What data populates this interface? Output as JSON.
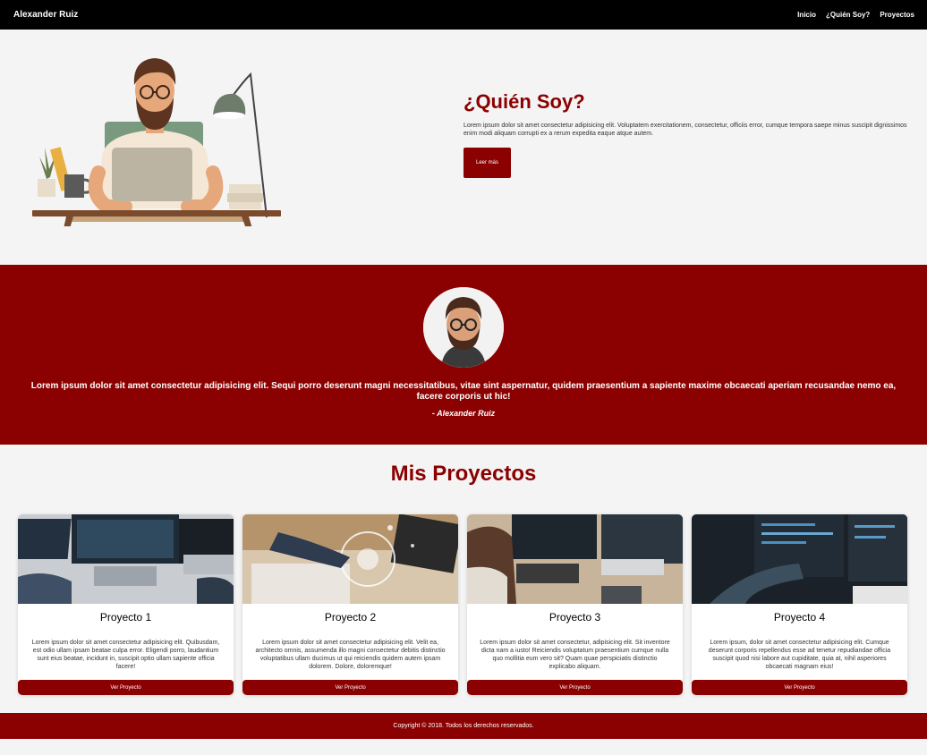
{
  "nav": {
    "brand": "Alexander Ruiz",
    "links": [
      "Inicio",
      "¿Quién Soy?",
      "Proyectos"
    ]
  },
  "about": {
    "title": "¿Quién Soy?",
    "description": "Lorem ipsum dolor sit amet consectetur adipisicing elit. Voluptatem exercitationem, consectetur, officiis error, cumque tempora saepe minus suscipit dignissimos enim modi aliquam corrupti ex a rerum expedita eaque atque autem.",
    "button_label": "Leer más"
  },
  "quote": {
    "text": "Lorem ipsum dolor sit amet consectetur adipisicing elit. Sequi porro deserunt magni necessitatibus, vitae sint aspernatur, quidem praesentium a sapiente maxime obcaecati aperiam recusandae nemo ea, facere corporis ut hic!",
    "author": "- Alexander Ruiz"
  },
  "projects": {
    "title": "Mis Proyectos",
    "items": [
      {
        "title": "Proyecto 1",
        "description": "Lorem ipsum dolor sit amet consectetur adipisicing elit. Quibusdam, est odio ullam ipsam beatae culpa error. Eligendi porro, laudantium sunt eius beatae, incidunt in, suscipit optio ullam sapiente officia facere!",
        "button_label": "Ver Proyecto"
      },
      {
        "title": "Proyecto 2",
        "description": "Lorem ipsum dolor sit amet consectetur adipisicing elit. Velit ea, architecto omnis, assumenda illo magni consectetur debitis distinctio voluptatibus ullam ducimus ut qui reiciendis quidem autem ipsam dolorem. Dolore, doloremque!",
        "button_label": "Ver Proyecto"
      },
      {
        "title": "Proyecto 3",
        "description": "Lorem ipsum dolor sit amet consectetur, adipisicing elit. Sit inventore dicta nam a iusto! Reiciendis voluptatum praesentium cumque nulla quo mollitia eum vero sit? Quam quae perspiciatis distinctio explicabo aliquam.",
        "button_label": "Ver Proyecto"
      },
      {
        "title": "Proyecto 4",
        "description": "Lorem ipsum, dolor sit amet consectetur adipisicing elit. Cumque deserunt corporis repellendus esse ad tenetur repudiandae officia suscipit quod nisi labore aut cupiditate, quia at, nihil asperiores obcaecati magnam eius!",
        "button_label": "Ver Proyecto"
      }
    ]
  },
  "footer": {
    "text": "Copyright © 2018. Todos los derechos reservados."
  },
  "colors": {
    "accent": "#8b0000",
    "navbar": "#000000",
    "background": "#f4f4f4"
  }
}
